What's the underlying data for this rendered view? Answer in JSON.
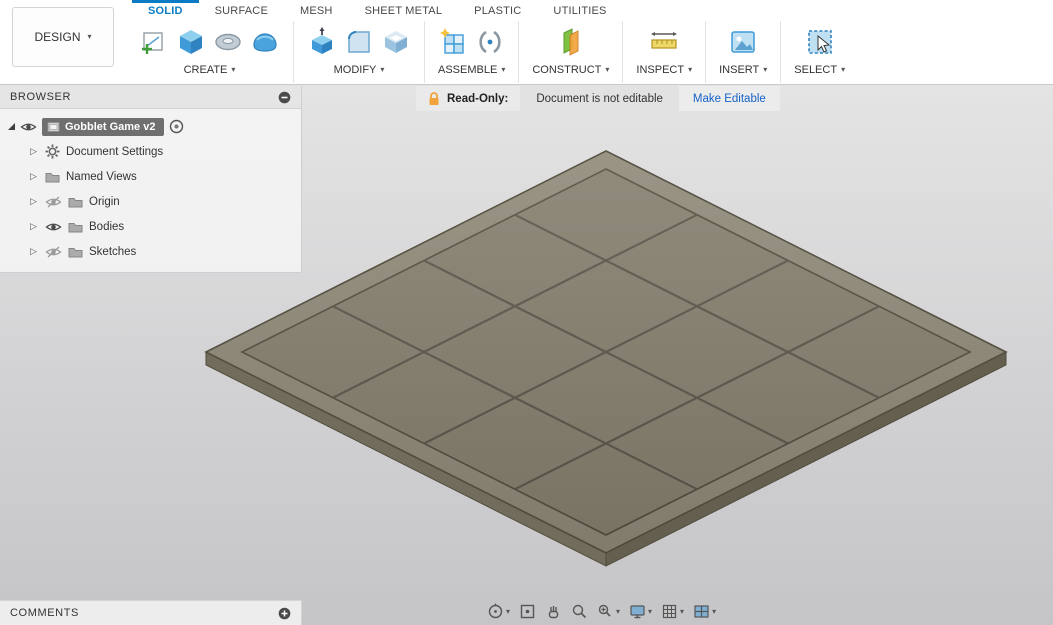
{
  "colors": {
    "accent_blue": "#0a7bc4",
    "link_blue": "#1663c7",
    "lock_orange": "#f2a33c",
    "board_rim": "#8f8978",
    "board_tile": "#857f6e",
    "board_side_left": "#726c5c",
    "board_side_right": "#655f50",
    "board_line": "#5b564a"
  },
  "toolbar": {
    "design_menu_label": "DESIGN",
    "tabs": [
      {
        "label": "SOLID",
        "active": true
      },
      {
        "label": "SURFACE",
        "active": false
      },
      {
        "label": "MESH",
        "active": false
      },
      {
        "label": "SHEET METAL",
        "active": false
      },
      {
        "label": "PLASTIC",
        "active": false
      },
      {
        "label": "UTILITIES",
        "active": false
      }
    ],
    "groups": [
      {
        "label": "CREATE"
      },
      {
        "label": "MODIFY"
      },
      {
        "label": "ASSEMBLE"
      },
      {
        "label": "CONSTRUCT"
      },
      {
        "label": "INSPECT"
      },
      {
        "label": "INSERT"
      },
      {
        "label": "SELECT"
      }
    ]
  },
  "banner": {
    "label": "Read-Only:",
    "message": "Document is not editable",
    "action": "Make Editable"
  },
  "browser": {
    "title": "BROWSER",
    "root": {
      "label": "Gobblet Game v2"
    },
    "items": [
      {
        "label": "Document Settings"
      },
      {
        "label": "Named Views"
      },
      {
        "label": "Origin"
      },
      {
        "label": "Bodies"
      },
      {
        "label": "Sketches"
      }
    ]
  },
  "comments": {
    "title": "COMMENTS"
  }
}
